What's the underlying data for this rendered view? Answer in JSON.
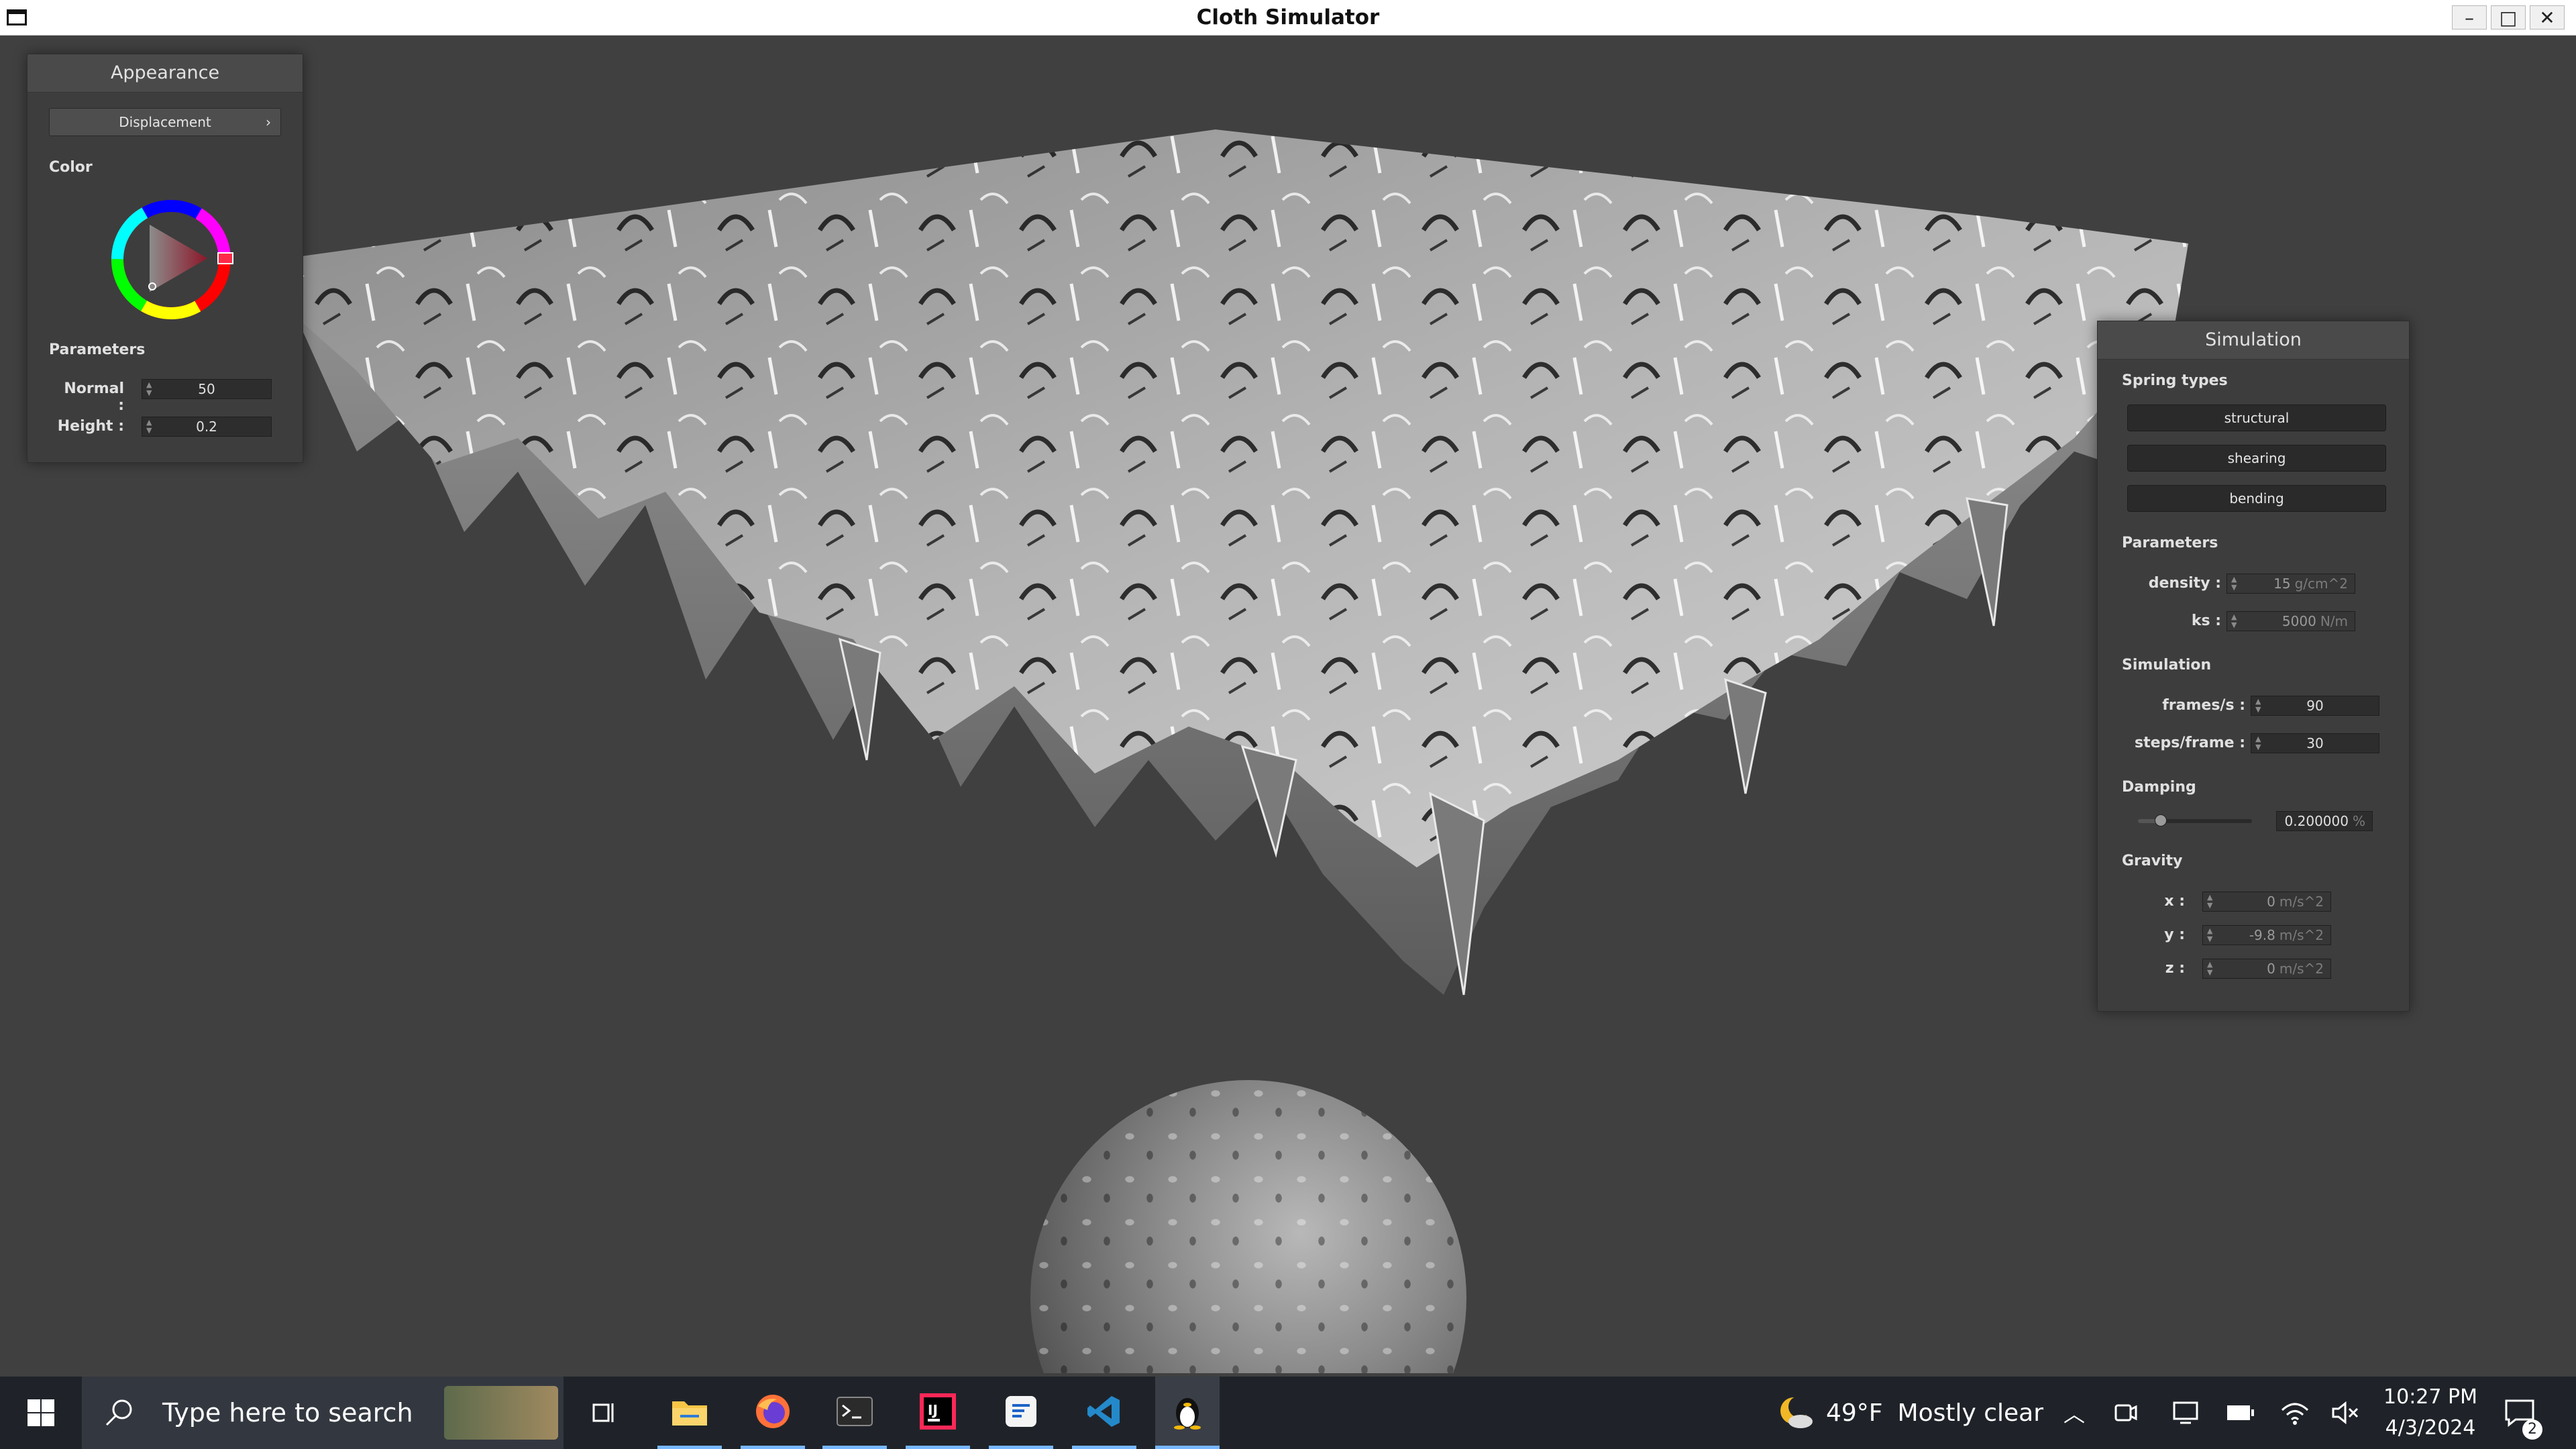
{
  "window": {
    "title": "Cloth Simulator"
  },
  "appearance": {
    "title": "Appearance",
    "shader_selected": "Displacement",
    "color_label": "Color",
    "parameters_label": "Parameters",
    "normal_label": "Normal :",
    "normal_value": "50",
    "height_label": "Height :",
    "height_value": "0.2",
    "color_value": "#ff2a4a"
  },
  "simulation_panel": {
    "title": "Simulation",
    "spring_types_label": "Spring types",
    "spring_types": [
      "structural",
      "shearing",
      "bending"
    ],
    "parameters_label": "Parameters",
    "density_label": "density :",
    "density_value": "15",
    "density_unit": "g/cm^2",
    "ks_label": "ks :",
    "ks_value": "5000",
    "ks_unit": "N/m",
    "simulation_label": "Simulation",
    "fps_label": "frames/s :",
    "fps_value": "90",
    "steps_label": "steps/frame :",
    "steps_value": "30",
    "damping_label": "Damping",
    "damping_value": "0.200000",
    "damping_unit": "%",
    "damping_slider_fraction": 0.2,
    "gravity_label": "Gravity",
    "gx_label": "x :",
    "gx_value": "0",
    "gy_label": "y :",
    "gy_value": "-9.8",
    "gz_label": "z :",
    "gz_value": "0",
    "gravity_unit": "m/s^2"
  },
  "taskbar": {
    "search_placeholder": "Type here to search",
    "weather_temp": "49°F",
    "weather_desc": "Mostly clear",
    "time": "10:27 PM",
    "date": "4/3/2024",
    "notification_count": "2"
  }
}
